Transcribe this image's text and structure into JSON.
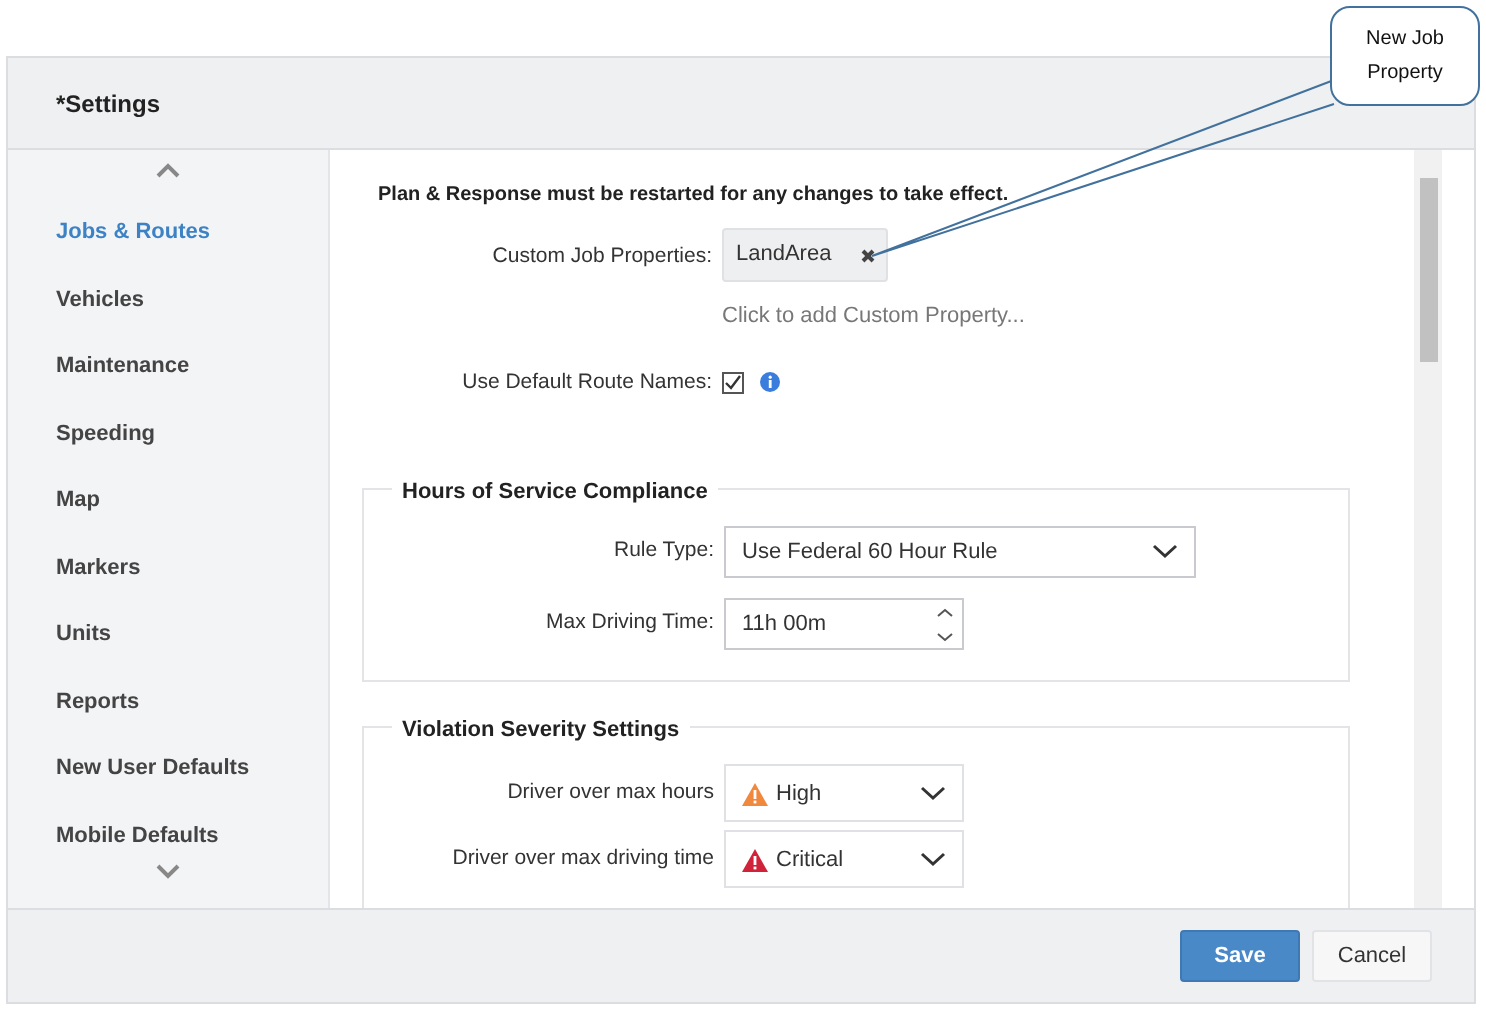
{
  "window": {
    "title": "*Settings"
  },
  "sidebar": {
    "items": [
      {
        "label": "Jobs & Routes",
        "selected": true
      },
      {
        "label": "Vehicles",
        "selected": false
      },
      {
        "label": "Maintenance",
        "selected": false
      },
      {
        "label": "Speeding",
        "selected": false
      },
      {
        "label": "Map",
        "selected": false
      },
      {
        "label": "Markers",
        "selected": false
      },
      {
        "label": "Units",
        "selected": false
      },
      {
        "label": "Reports",
        "selected": false
      },
      {
        "label": "New User Defaults",
        "selected": false
      },
      {
        "label": "Mobile Defaults",
        "selected": false
      }
    ]
  },
  "notice": "Plan & Response must be restarted for any changes to take effect.",
  "custom_job_properties": {
    "label": "Custom Job Properties:",
    "tags": [
      {
        "label": "LandArea"
      }
    ],
    "add_link": "Click to add Custom Property..."
  },
  "use_default_route_names": {
    "label": "Use Default Route Names:",
    "checked": true
  },
  "hours_of_service": {
    "title": "Hours of Service Compliance",
    "rule_type": {
      "label": "Rule Type:",
      "value": "Use Federal 60 Hour Rule"
    },
    "max_driving_time": {
      "label": "Max Driving Time:",
      "value": "11h 00m"
    }
  },
  "violation_severity": {
    "title": "Violation Severity Settings",
    "rows": [
      {
        "label": "Driver over max hours",
        "value": "High",
        "color": "#f0883e"
      },
      {
        "label": "Driver over max driving time",
        "value": "Critical",
        "color": "#d0233a"
      }
    ]
  },
  "buttons": [
    {
      "label": "Save",
      "kind": "primary"
    },
    {
      "label": "Cancel",
      "kind": "secondary"
    }
  ],
  "callout": {
    "text": "New Job Property"
  }
}
